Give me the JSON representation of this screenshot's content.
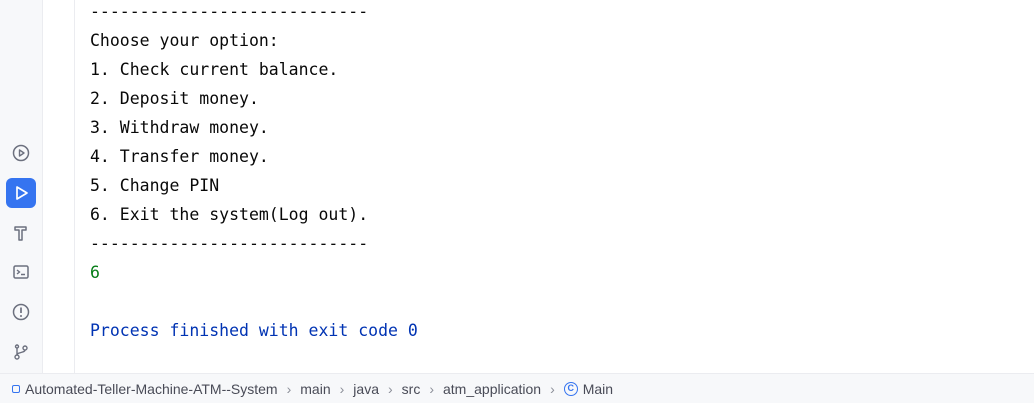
{
  "console": {
    "lines": [
      "----------------------------",
      "Choose your option:",
      "1. Check current balance.",
      "2. Deposit money.",
      "3. Withdraw money.",
      "4. Transfer money.",
      "5. Change PIN",
      "6. Exit the system(Log out).",
      "----------------------------",
      "6",
      "",
      "Process finished with exit code 0"
    ]
  },
  "toolbar": {
    "buttons": [
      {
        "name": "services-icon",
        "active": false
      },
      {
        "name": "run-icon",
        "active": true
      },
      {
        "name": "build-icon",
        "active": false
      },
      {
        "name": "terminal-icon",
        "active": false
      },
      {
        "name": "problems-icon",
        "active": false
      },
      {
        "name": "git-icon",
        "active": false
      }
    ]
  },
  "breadcrumbs": {
    "items": [
      "Automated-Teller-Machine-ATM--System",
      "main",
      "java",
      "src",
      "atm_application",
      "Main"
    ]
  },
  "colors": {
    "accent": "#3574f0",
    "input_text": "#067d17",
    "system_text": "#0033b3"
  }
}
